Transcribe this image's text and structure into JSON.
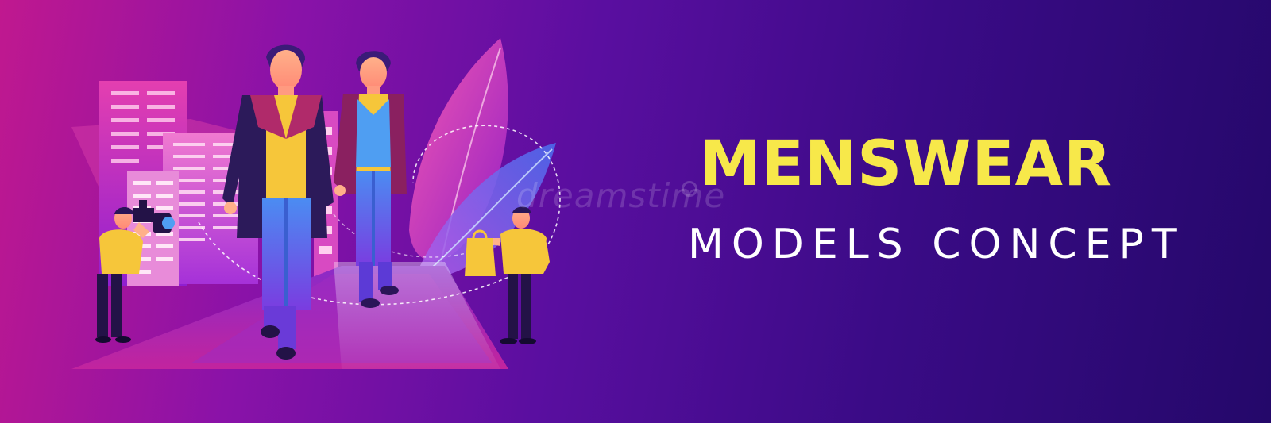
{
  "banner": {
    "headline": "MENSWEAR",
    "subline": "MODELS CONCEPT",
    "watermark": "dreamstime"
  },
  "colors": {
    "headline": "#f7e84a",
    "subline": "#ffffff",
    "background_start": "#c0188f",
    "background_end": "#24086a",
    "accent_yellow": "#f6c63a",
    "accent_blue": "#3a7fe6"
  },
  "illustration": {
    "elements": [
      "city-buildings",
      "runway",
      "leaf-shapes",
      "male-model-coat",
      "male-model-vest",
      "photographer",
      "shopper-with-bag"
    ]
  }
}
